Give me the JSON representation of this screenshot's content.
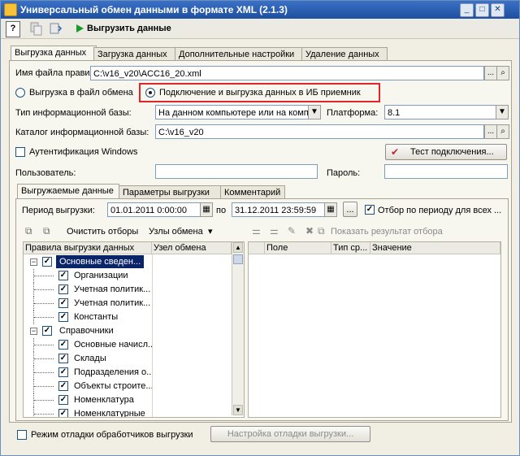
{
  "window": {
    "title": "Универсальный обмен данными в формате XML (2.1.3)"
  },
  "toolbar": {
    "help_label": "?",
    "run_label": "Выгрузить данные"
  },
  "main_tabs": [
    {
      "label": "Выгрузка данных"
    },
    {
      "label": "Загрузка данных"
    },
    {
      "label": "Дополнительные настройки"
    },
    {
      "label": "Удаление данных"
    }
  ],
  "rules_file": {
    "label": "Имя файла правил:",
    "value": "C:\\v16_v20\\ACC16_20.xml"
  },
  "export_mode": {
    "option_file": "Выгрузка в файл обмена",
    "option_db": "Подключение и выгрузка данных в ИБ приемник",
    "selected": "db",
    "highlight_color": "#e0262b"
  },
  "db_type": {
    "label": "Тип информационной базы:",
    "value": "На данном компьютере или на комп"
  },
  "platform": {
    "label": "Платформа:",
    "value": "8.1"
  },
  "db_catalog": {
    "label": "Каталог информационной базы:",
    "value": "C:\\v16_v20"
  },
  "auth": {
    "label": "Аутентификация Windows",
    "checked": false
  },
  "test_button": {
    "label": "Тест подключения..."
  },
  "user": {
    "label": "Пользователь:",
    "value": ""
  },
  "password": {
    "label": "Пароль:",
    "value": ""
  },
  "sub_tabs": [
    {
      "label": "Выгружаемые данные"
    },
    {
      "label": "Параметры выгрузки"
    },
    {
      "label": "Комментарий"
    }
  ],
  "period": {
    "label": "Период выгрузки:",
    "from": "01.01.2011  0:00:00",
    "to_label": "по",
    "to": "31.12.2011 23:59:59",
    "ellipsis": "...",
    "filter_label": "Отбор по периоду для всех ...",
    "filter_checked": true
  },
  "left_toolbar": {
    "clear_label": "Очистить отборы",
    "nodes_label": "Узлы обмена"
  },
  "right_toolbar": {
    "show_result_label": "Показать результат отбора"
  },
  "rules_table": {
    "columns": [
      "Правила выгрузки данных",
      "Узел обмена"
    ],
    "rows": [
      {
        "label": "Основные сведен...",
        "level": 0,
        "expander": "−",
        "selected": true
      },
      {
        "label": "Организации",
        "level": 1
      },
      {
        "label": "Учетная политик...",
        "level": 1
      },
      {
        "label": "Учетная политик...",
        "level": 1
      },
      {
        "label": "Константы",
        "level": 1
      },
      {
        "label": "Справочники",
        "level": 0,
        "expander": "−"
      },
      {
        "label": "Основные начисл...",
        "level": 1
      },
      {
        "label": "Склады",
        "level": 1
      },
      {
        "label": "Подразделения о...",
        "level": 1
      },
      {
        "label": "Объекты строите...",
        "level": 1
      },
      {
        "label": "Номенклатура",
        "level": 1
      },
      {
        "label": "Номенклатурные",
        "level": 1
      }
    ]
  },
  "filter_table": {
    "columns": [
      "Поле",
      "Тип ср...",
      "Значение"
    ]
  },
  "debug": {
    "label": "Режим отладки обработчиков выгрузки",
    "checked": false,
    "settings_label": "Настройка отладки выгрузки..."
  }
}
